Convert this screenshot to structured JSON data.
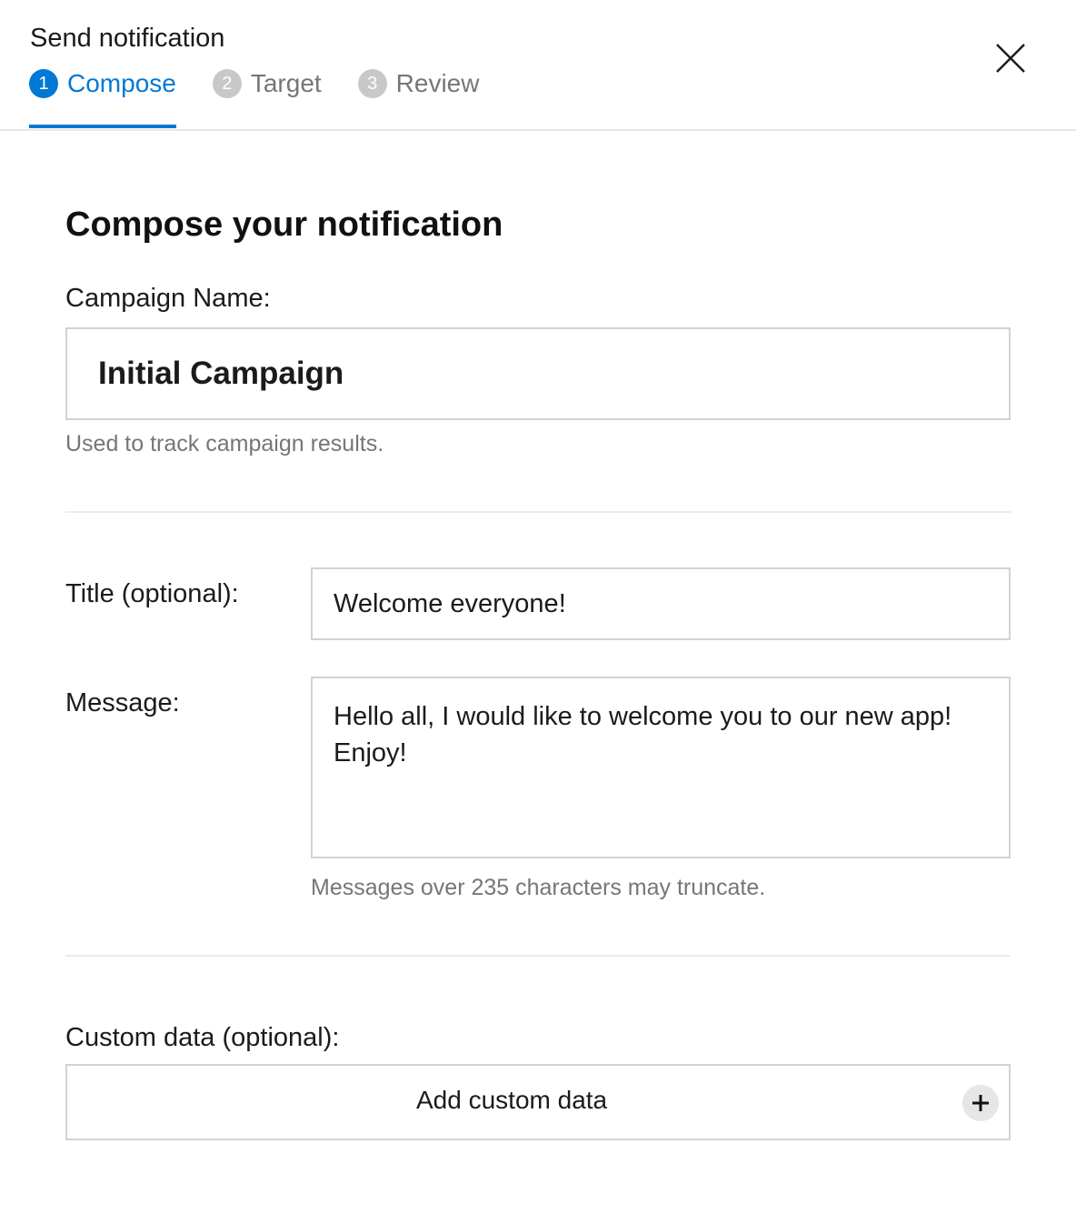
{
  "dialog": {
    "title": "Send notification",
    "close_icon": "close-icon"
  },
  "steps": [
    {
      "number": "1",
      "label": "Compose",
      "active": true
    },
    {
      "number": "2",
      "label": "Target",
      "active": false
    },
    {
      "number": "3",
      "label": "Review",
      "active": false
    }
  ],
  "compose": {
    "heading": "Compose your notification",
    "campaign": {
      "label": "Campaign Name:",
      "value": "Initial Campaign",
      "help": "Used to track campaign results."
    },
    "title_field": {
      "label": "Title (optional):",
      "value": "Welcome everyone!"
    },
    "message_field": {
      "label": "Message:",
      "value": "Hello all, I would like to welcome you to our new app! Enjoy!",
      "help": "Messages over 235 characters may truncate."
    },
    "custom_data": {
      "label": "Custom data (optional):",
      "button_label": "Add custom data",
      "icon": "plus-icon"
    }
  },
  "colors": {
    "accent": "#0078d4",
    "inactive_step": "#c8c8c8",
    "help_text": "#767676",
    "border": "#d2d2d2"
  }
}
